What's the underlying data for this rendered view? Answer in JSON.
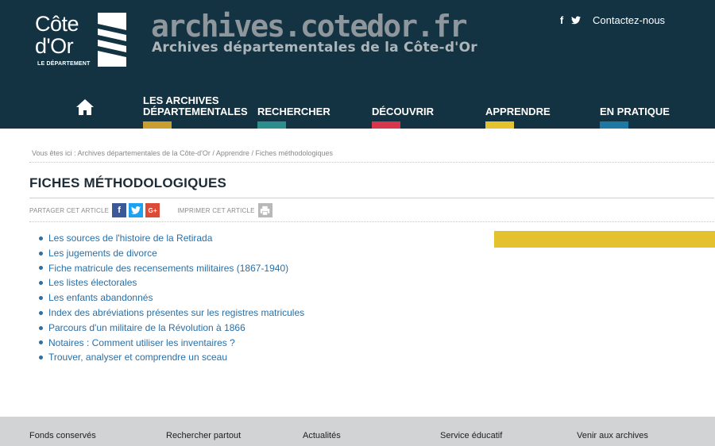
{
  "header": {
    "logo_line1": "Côte",
    "logo_line2": "d'Or",
    "logo_sub": "LE DÉPARTEMENT",
    "site_title": "archives.cotedor.fr",
    "site_subtitle": "Archives départementales de la Côte-d'Or",
    "contact_label": "Contactez-nous",
    "facebook_glyph": "f",
    "bg_color": "#133343"
  },
  "nav": {
    "home_icon": "home-icon",
    "items": [
      {
        "line1": "LES ARCHIVES",
        "line2": "DÉPARTEMENTALES",
        "color": "#c99d30"
      },
      {
        "line1": "RECHERCHER",
        "line2": "",
        "color": "#2c8e8e"
      },
      {
        "line1": "DÉCOUVRIR",
        "line2": "",
        "color": "#d8364b"
      },
      {
        "line1": "APPRENDRE",
        "line2": "",
        "color": "#e4c22e"
      },
      {
        "line1": "EN PRATIQUE",
        "line2": "",
        "color": "#1d78a4"
      }
    ]
  },
  "breadcrumb": {
    "prefix": "Vous êtes ici :",
    "items": [
      "Archives départementales de la Côte-d'Or",
      "Apprendre",
      "Fiches méthodologiques"
    ],
    "separator": "/"
  },
  "page_title": "FICHES MÉTHODOLOGIQUES",
  "share": {
    "share_label": "PARTAGER CET ARTICLE",
    "facebook_glyph": "f",
    "google_glyph": "G+",
    "print_label": "IMPRIMER CET ARTICLE"
  },
  "links": [
    "Les sources de l'histoire de la Retirada",
    "Les jugements de divorce",
    "Fiche matricule des recensements militaires (1867-1940)",
    "Les listes électorales",
    "Les enfants abandonnés",
    "Index des abréviations présentes sur les registres matricules",
    "Parcours d'un militaire de la Révolution à 1866",
    "Notaires : Comment utiliser les inventaires ?",
    "Trouver, analyser et comprendre un sceau"
  ],
  "footer": {
    "links": [
      "Fonds conservés",
      "Rechercher partout",
      "Actualités",
      "Service éducatif",
      "Venir aux archives"
    ]
  }
}
